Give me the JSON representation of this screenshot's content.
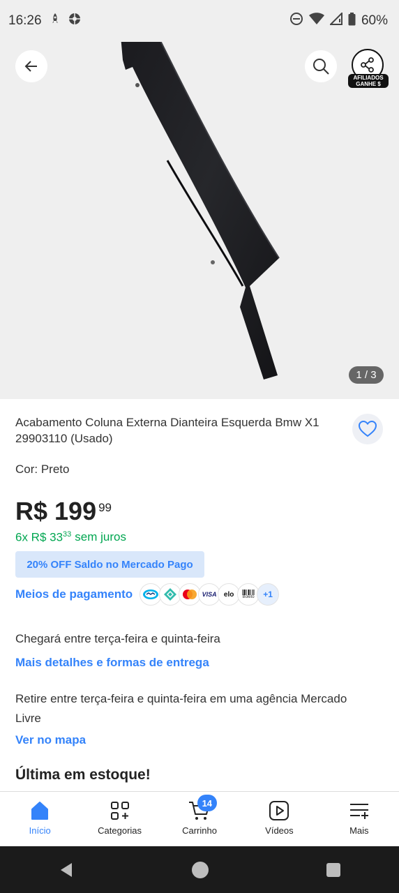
{
  "status_bar": {
    "time": "16:26",
    "battery": "60%"
  },
  "gallery": {
    "counter": "1 / 3",
    "affiliate_badge_line1": "AFILIADOS",
    "affiliate_badge_line2": "GANHE $"
  },
  "product": {
    "title": "Acabamento Coluna Externa Dianteira Esquerda Bmw X1 29903110 (Usado)",
    "color_label": "Cor: Preto",
    "price_main": "R$ 199",
    "price_cents": "99",
    "installments_prefix": "6x R$ 33",
    "installments_cents": "33",
    "installments_suffix": "sem juros",
    "promo": "20% OFF Saldo no Mercado Pago",
    "payment_link": "Meios de pagamento",
    "payment_icons": [
      "mercado-pago-icon",
      "pix-icon",
      "mastercard-icon",
      "visa-icon",
      "elo-icon",
      "boleto-icon"
    ],
    "payment_visa": "VISA",
    "payment_elo": "elo",
    "payment_boleto": "Boleto",
    "payment_more": "+1",
    "shipping_text": "Chegará entre terça-feira e quinta-feira",
    "shipping_link": "Mais detalhes e formas de entrega",
    "pickup_text": "Retire entre terça-feira e quinta-feira em uma agência Mercado Livre",
    "map_link": "Ver no mapa",
    "stock": "Última em estoque!"
  },
  "bottom_nav": {
    "items": [
      {
        "label": "Início",
        "icon": "home-icon",
        "active": true
      },
      {
        "label": "Categorias",
        "icon": "categories-icon",
        "active": false
      },
      {
        "label": "Carrinho",
        "icon": "cart-icon",
        "active": false,
        "badge": "14"
      },
      {
        "label": "Vídeos",
        "icon": "video-icon",
        "active": false
      },
      {
        "label": "Mais",
        "icon": "menu-icon",
        "active": false
      }
    ]
  },
  "colors": {
    "accent": "#3483fa",
    "green": "#00a650",
    "promo_bg": "#d9e7fa"
  }
}
